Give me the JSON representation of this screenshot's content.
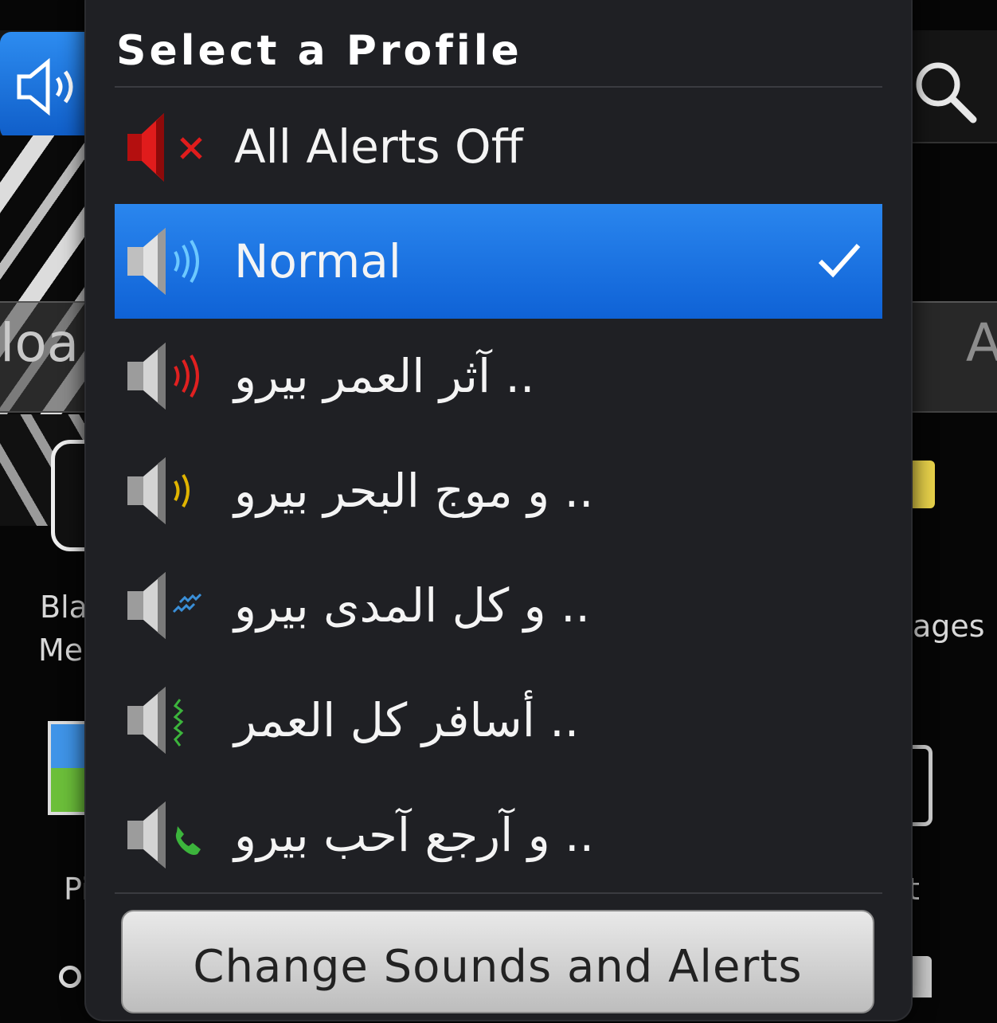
{
  "dialog": {
    "title": "Select a Profile",
    "items": [
      {
        "label": "All Alerts Off",
        "icon": "speaker-muted-icon",
        "selected": false
      },
      {
        "label": "Normal",
        "icon": "speaker-normal-icon",
        "selected": true
      },
      {
        "label": "آثر العمر بيرو ..",
        "icon": "speaker-loud-icon",
        "selected": false
      },
      {
        "label": "و موج البحر بيرو ..",
        "icon": "speaker-medium-icon",
        "selected": false
      },
      {
        "label": "و كل المدى بيرو ..",
        "icon": "speaker-vibrate-icon",
        "selected": false
      },
      {
        "label": "أسافر كل العمر ..",
        "icon": "speaker-quiet-icon",
        "selected": false
      },
      {
        "label": "و آرجع آحب بيرو ..",
        "icon": "speaker-phone-only-icon",
        "selected": false
      }
    ],
    "change_button": "Change Sounds and Alerts"
  },
  "background": {
    "strip_left_text": "loa",
    "strip_right_text": "A",
    "app_left_1": "Bla",
    "app_left_2": "Me",
    "app_right": "ages",
    "app_left_bottom": "Pi",
    "app_right_bottom": "t"
  },
  "colors": {
    "selection": "#1a74e2",
    "dialog_bg": "#1f2024",
    "muted_speaker": "#d11a1a"
  }
}
